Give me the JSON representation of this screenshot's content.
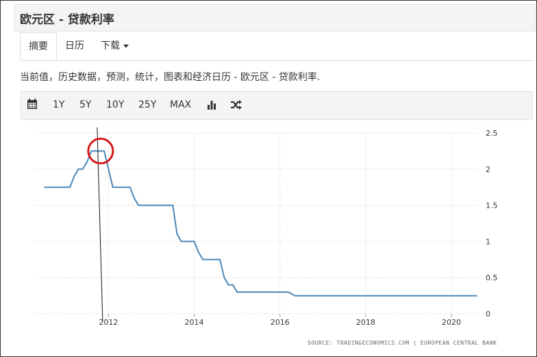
{
  "header": {
    "title": "欧元区 - 贷款利率"
  },
  "tabs": [
    {
      "label": "摘要"
    },
    {
      "label": "日历"
    },
    {
      "label": "下载"
    }
  ],
  "description": "当前值，历史数据，预测，统计，图表和经济日历 - 欧元区 - 贷款利率.",
  "toolbar": {
    "ranges": [
      "1Y",
      "5Y",
      "10Y",
      "25Y",
      "MAX"
    ],
    "icons": [
      "calendar-icon",
      "bar-chart-icon",
      "shuffle-icon"
    ]
  },
  "source": "SOURCE: TRADINGECONOMICS.COM | EUROPEAN CENTRAL BANK",
  "colors": {
    "line": "#4a86b8",
    "highlight": "#d7191c"
  },
  "chart_data": {
    "type": "line",
    "title": "",
    "xlabel": "",
    "ylabel": "",
    "x_ticks": [
      "2012",
      "2014",
      "2016",
      "2018",
      "2020"
    ],
    "y_ticks": [
      "0",
      "0.5",
      "1",
      "1.5",
      "2",
      "2.5"
    ],
    "ylim": [
      0,
      2.5
    ],
    "xlim": [
      2010.3,
      2020.75
    ],
    "grid": true,
    "series": [
      {
        "name": "",
        "x": [
          2010.5,
          2011.1,
          2011.2,
          2011.3,
          2011.4,
          2011.5,
          2011.6,
          2011.75,
          2011.9,
          2012.0,
          2012.1,
          2012.5,
          2012.6,
          2012.7,
          2013.5,
          2013.6,
          2013.7,
          2014.0,
          2014.1,
          2014.2,
          2014.6,
          2014.7,
          2014.8,
          2014.9,
          2015.0,
          2016.2,
          2016.35,
          2020.6
        ],
        "y": [
          1.75,
          1.75,
          1.9,
          2.0,
          2.0,
          2.1,
          2.25,
          2.25,
          2.25,
          2.0,
          1.75,
          1.75,
          1.6,
          1.5,
          1.5,
          1.1,
          1.0,
          1.0,
          0.85,
          0.75,
          0.75,
          0.5,
          0.4,
          0.4,
          0.3,
          0.3,
          0.25,
          0.25
        ]
      }
    ],
    "annotation": {
      "type": "circle",
      "x": 2011.8,
      "y": 2.25
    }
  }
}
